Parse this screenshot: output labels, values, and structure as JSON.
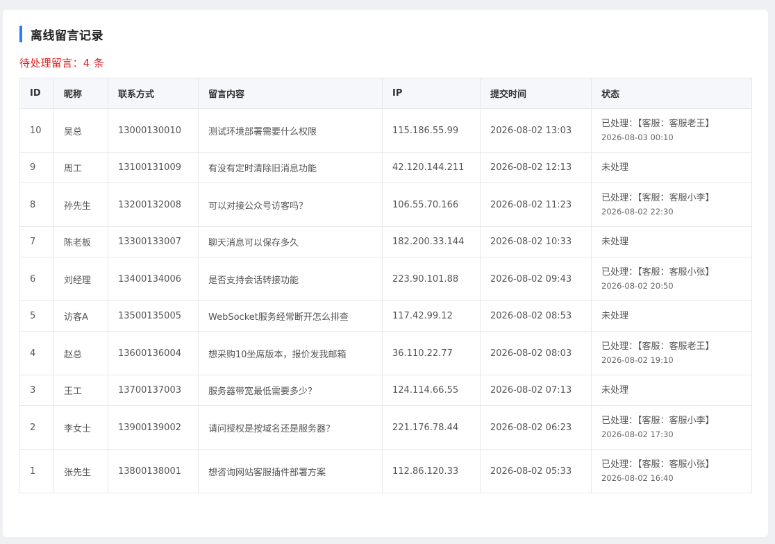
{
  "panel": {
    "title": "离线留言记录",
    "pending_text": "待处理留言：4 条"
  },
  "table": {
    "headers": [
      "ID",
      "昵称",
      "联系方式",
      "留言内容",
      "IP",
      "提交时间",
      "状态"
    ],
    "rows": [
      {
        "id": "10",
        "nickname": "吴总",
        "contact": "13000130010",
        "message": "测试环境部署需要什么权限",
        "ip": "115.186.55.99",
        "submitted": "2026-08-02 13:03",
        "status": "已处理：【客服：客服老王】",
        "handled_time": "2026-08-03 00:10"
      },
      {
        "id": "9",
        "nickname": "周工",
        "contact": "13100131009",
        "message": "有没有定时清除旧消息功能",
        "ip": "42.120.144.211",
        "submitted": "2026-08-02 12:13",
        "status": "未处理",
        "handled_time": ""
      },
      {
        "id": "8",
        "nickname": "孙先生",
        "contact": "13200132008",
        "message": "可以对接公众号访客吗？",
        "ip": "106.55.70.166",
        "submitted": "2026-08-02 11:23",
        "status": "已处理：【客服：客服小李】",
        "handled_time": "2026-08-02 22:30"
      },
      {
        "id": "7",
        "nickname": "陈老板",
        "contact": "13300133007",
        "message": "聊天消息可以保存多久",
        "ip": "182.200.33.144",
        "submitted": "2026-08-02 10:33",
        "status": "未处理",
        "handled_time": ""
      },
      {
        "id": "6",
        "nickname": "刘经理",
        "contact": "13400134006",
        "message": "是否支持会话转接功能",
        "ip": "223.90.101.88",
        "submitted": "2026-08-02 09:43",
        "status": "已处理：【客服：客服小张】",
        "handled_time": "2026-08-02 20:50"
      },
      {
        "id": "5",
        "nickname": "访客A",
        "contact": "13500135005",
        "message": "WebSocket服务经常断开怎么排查",
        "ip": "117.42.99.12",
        "submitted": "2026-08-02 08:53",
        "status": "未处理",
        "handled_time": ""
      },
      {
        "id": "4",
        "nickname": "赵总",
        "contact": "13600136004",
        "message": "想采购10坐席版本，报价发我邮箱",
        "ip": "36.110.22.77",
        "submitted": "2026-08-02 08:03",
        "status": "已处理：【客服：客服老王】",
        "handled_time": "2026-08-02 19:10"
      },
      {
        "id": "3",
        "nickname": "王工",
        "contact": "13700137003",
        "message": "服务器带宽最低需要多少？",
        "ip": "124.114.66.55",
        "submitted": "2026-08-02 07:13",
        "status": "未处理",
        "handled_time": ""
      },
      {
        "id": "2",
        "nickname": "李女士",
        "contact": "13900139002",
        "message": "请问授权是按域名还是服务器？",
        "ip": "221.176.78.44",
        "submitted": "2026-08-02 06:23",
        "status": "已处理：【客服：客服小李】",
        "handled_time": "2026-08-02 17:30"
      },
      {
        "id": "1",
        "nickname": "张先生",
        "contact": "13800138001",
        "message": "想咨询网站客服插件部署方案",
        "ip": "112.86.120.33",
        "submitted": "2026-08-02 05:33",
        "status": "已处理：【客服：客服小张】",
        "handled_time": "2026-08-02 16:40"
      }
    ]
  }
}
